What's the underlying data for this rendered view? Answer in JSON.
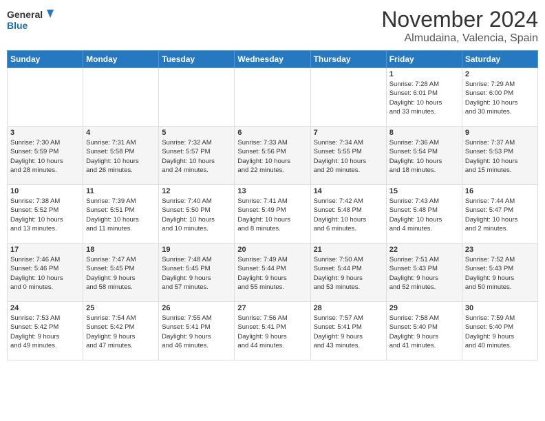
{
  "logo": {
    "text_general": "General",
    "text_blue": "Blue"
  },
  "header": {
    "month": "November 2024",
    "location": "Almudaina, Valencia, Spain"
  },
  "weekdays": [
    "Sunday",
    "Monday",
    "Tuesday",
    "Wednesday",
    "Thursday",
    "Friday",
    "Saturday"
  ],
  "weeks": [
    [
      {
        "day": "",
        "info": ""
      },
      {
        "day": "",
        "info": ""
      },
      {
        "day": "",
        "info": ""
      },
      {
        "day": "",
        "info": ""
      },
      {
        "day": "",
        "info": ""
      },
      {
        "day": "1",
        "info": "Sunrise: 7:28 AM\nSunset: 6:01 PM\nDaylight: 10 hours\nand 33 minutes."
      },
      {
        "day": "2",
        "info": "Sunrise: 7:29 AM\nSunset: 6:00 PM\nDaylight: 10 hours\nand 30 minutes."
      }
    ],
    [
      {
        "day": "3",
        "info": "Sunrise: 7:30 AM\nSunset: 5:59 PM\nDaylight: 10 hours\nand 28 minutes."
      },
      {
        "day": "4",
        "info": "Sunrise: 7:31 AM\nSunset: 5:58 PM\nDaylight: 10 hours\nand 26 minutes."
      },
      {
        "day": "5",
        "info": "Sunrise: 7:32 AM\nSunset: 5:57 PM\nDaylight: 10 hours\nand 24 minutes."
      },
      {
        "day": "6",
        "info": "Sunrise: 7:33 AM\nSunset: 5:56 PM\nDaylight: 10 hours\nand 22 minutes."
      },
      {
        "day": "7",
        "info": "Sunrise: 7:34 AM\nSunset: 5:55 PM\nDaylight: 10 hours\nand 20 minutes."
      },
      {
        "day": "8",
        "info": "Sunrise: 7:36 AM\nSunset: 5:54 PM\nDaylight: 10 hours\nand 18 minutes."
      },
      {
        "day": "9",
        "info": "Sunrise: 7:37 AM\nSunset: 5:53 PM\nDaylight: 10 hours\nand 15 minutes."
      }
    ],
    [
      {
        "day": "10",
        "info": "Sunrise: 7:38 AM\nSunset: 5:52 PM\nDaylight: 10 hours\nand 13 minutes."
      },
      {
        "day": "11",
        "info": "Sunrise: 7:39 AM\nSunset: 5:51 PM\nDaylight: 10 hours\nand 11 minutes."
      },
      {
        "day": "12",
        "info": "Sunrise: 7:40 AM\nSunset: 5:50 PM\nDaylight: 10 hours\nand 10 minutes."
      },
      {
        "day": "13",
        "info": "Sunrise: 7:41 AM\nSunset: 5:49 PM\nDaylight: 10 hours\nand 8 minutes."
      },
      {
        "day": "14",
        "info": "Sunrise: 7:42 AM\nSunset: 5:48 PM\nDaylight: 10 hours\nand 6 minutes."
      },
      {
        "day": "15",
        "info": "Sunrise: 7:43 AM\nSunset: 5:48 PM\nDaylight: 10 hours\nand 4 minutes."
      },
      {
        "day": "16",
        "info": "Sunrise: 7:44 AM\nSunset: 5:47 PM\nDaylight: 10 hours\nand 2 minutes."
      }
    ],
    [
      {
        "day": "17",
        "info": "Sunrise: 7:46 AM\nSunset: 5:46 PM\nDaylight: 10 hours\nand 0 minutes."
      },
      {
        "day": "18",
        "info": "Sunrise: 7:47 AM\nSunset: 5:45 PM\nDaylight: 9 hours\nand 58 minutes."
      },
      {
        "day": "19",
        "info": "Sunrise: 7:48 AM\nSunset: 5:45 PM\nDaylight: 9 hours\nand 57 minutes."
      },
      {
        "day": "20",
        "info": "Sunrise: 7:49 AM\nSunset: 5:44 PM\nDaylight: 9 hours\nand 55 minutes."
      },
      {
        "day": "21",
        "info": "Sunrise: 7:50 AM\nSunset: 5:44 PM\nDaylight: 9 hours\nand 53 minutes."
      },
      {
        "day": "22",
        "info": "Sunrise: 7:51 AM\nSunset: 5:43 PM\nDaylight: 9 hours\nand 52 minutes."
      },
      {
        "day": "23",
        "info": "Sunrise: 7:52 AM\nSunset: 5:43 PM\nDaylight: 9 hours\nand 50 minutes."
      }
    ],
    [
      {
        "day": "24",
        "info": "Sunrise: 7:53 AM\nSunset: 5:42 PM\nDaylight: 9 hours\nand 49 minutes."
      },
      {
        "day": "25",
        "info": "Sunrise: 7:54 AM\nSunset: 5:42 PM\nDaylight: 9 hours\nand 47 minutes."
      },
      {
        "day": "26",
        "info": "Sunrise: 7:55 AM\nSunset: 5:41 PM\nDaylight: 9 hours\nand 46 minutes."
      },
      {
        "day": "27",
        "info": "Sunrise: 7:56 AM\nSunset: 5:41 PM\nDaylight: 9 hours\nand 44 minutes."
      },
      {
        "day": "28",
        "info": "Sunrise: 7:57 AM\nSunset: 5:41 PM\nDaylight: 9 hours\nand 43 minutes."
      },
      {
        "day": "29",
        "info": "Sunrise: 7:58 AM\nSunset: 5:40 PM\nDaylight: 9 hours\nand 41 minutes."
      },
      {
        "day": "30",
        "info": "Sunrise: 7:59 AM\nSunset: 5:40 PM\nDaylight: 9 hours\nand 40 minutes."
      }
    ]
  ]
}
